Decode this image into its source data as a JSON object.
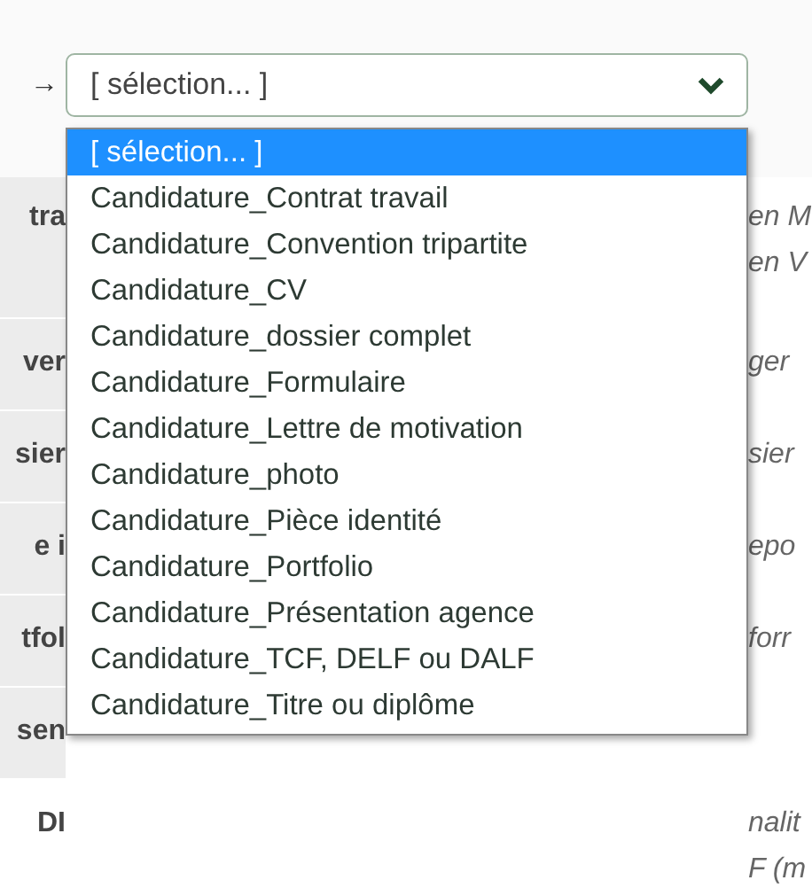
{
  "arrow": "→",
  "select": {
    "value": "[ sélection... ]",
    "open": true
  },
  "options": [
    {
      "label": "[ sélection... ]",
      "selected": true
    },
    {
      "label": "Candidature_Contrat travail",
      "selected": false
    },
    {
      "label": "Candidature_Convention tripartite",
      "selected": false
    },
    {
      "label": "Candidature_CV",
      "selected": false
    },
    {
      "label": "Candidature_dossier complet",
      "selected": false
    },
    {
      "label": "Candidature_Formulaire",
      "selected": false
    },
    {
      "label": "Candidature_Lettre de motivation",
      "selected": false
    },
    {
      "label": "Candidature_photo",
      "selected": false
    },
    {
      "label": "Candidature_Pièce identité",
      "selected": false
    },
    {
      "label": "Candidature_Portfolio",
      "selected": false
    },
    {
      "label": "Candidature_Présentation agence",
      "selected": false
    },
    {
      "label": "Candidature_TCF, DELF ou DALF",
      "selected": false
    },
    {
      "label": "Candidature_Titre ou diplôme",
      "selected": false
    }
  ],
  "rows": [
    {
      "label": "tra",
      "notes": [
        "en M",
        "en V"
      ]
    },
    {
      "label": "ver",
      "notes": [
        "ger"
      ]
    },
    {
      "label": "sier",
      "notes": [
        "sier"
      ]
    },
    {
      "label": "e i",
      "notes": [
        "epo"
      ]
    },
    {
      "label": "tfol",
      "notes": [
        "forr"
      ]
    },
    {
      "label": "sen",
      "notes": []
    },
    {
      "label": "DI",
      "notes": [
        "nalit",
        "F (m"
      ]
    }
  ]
}
